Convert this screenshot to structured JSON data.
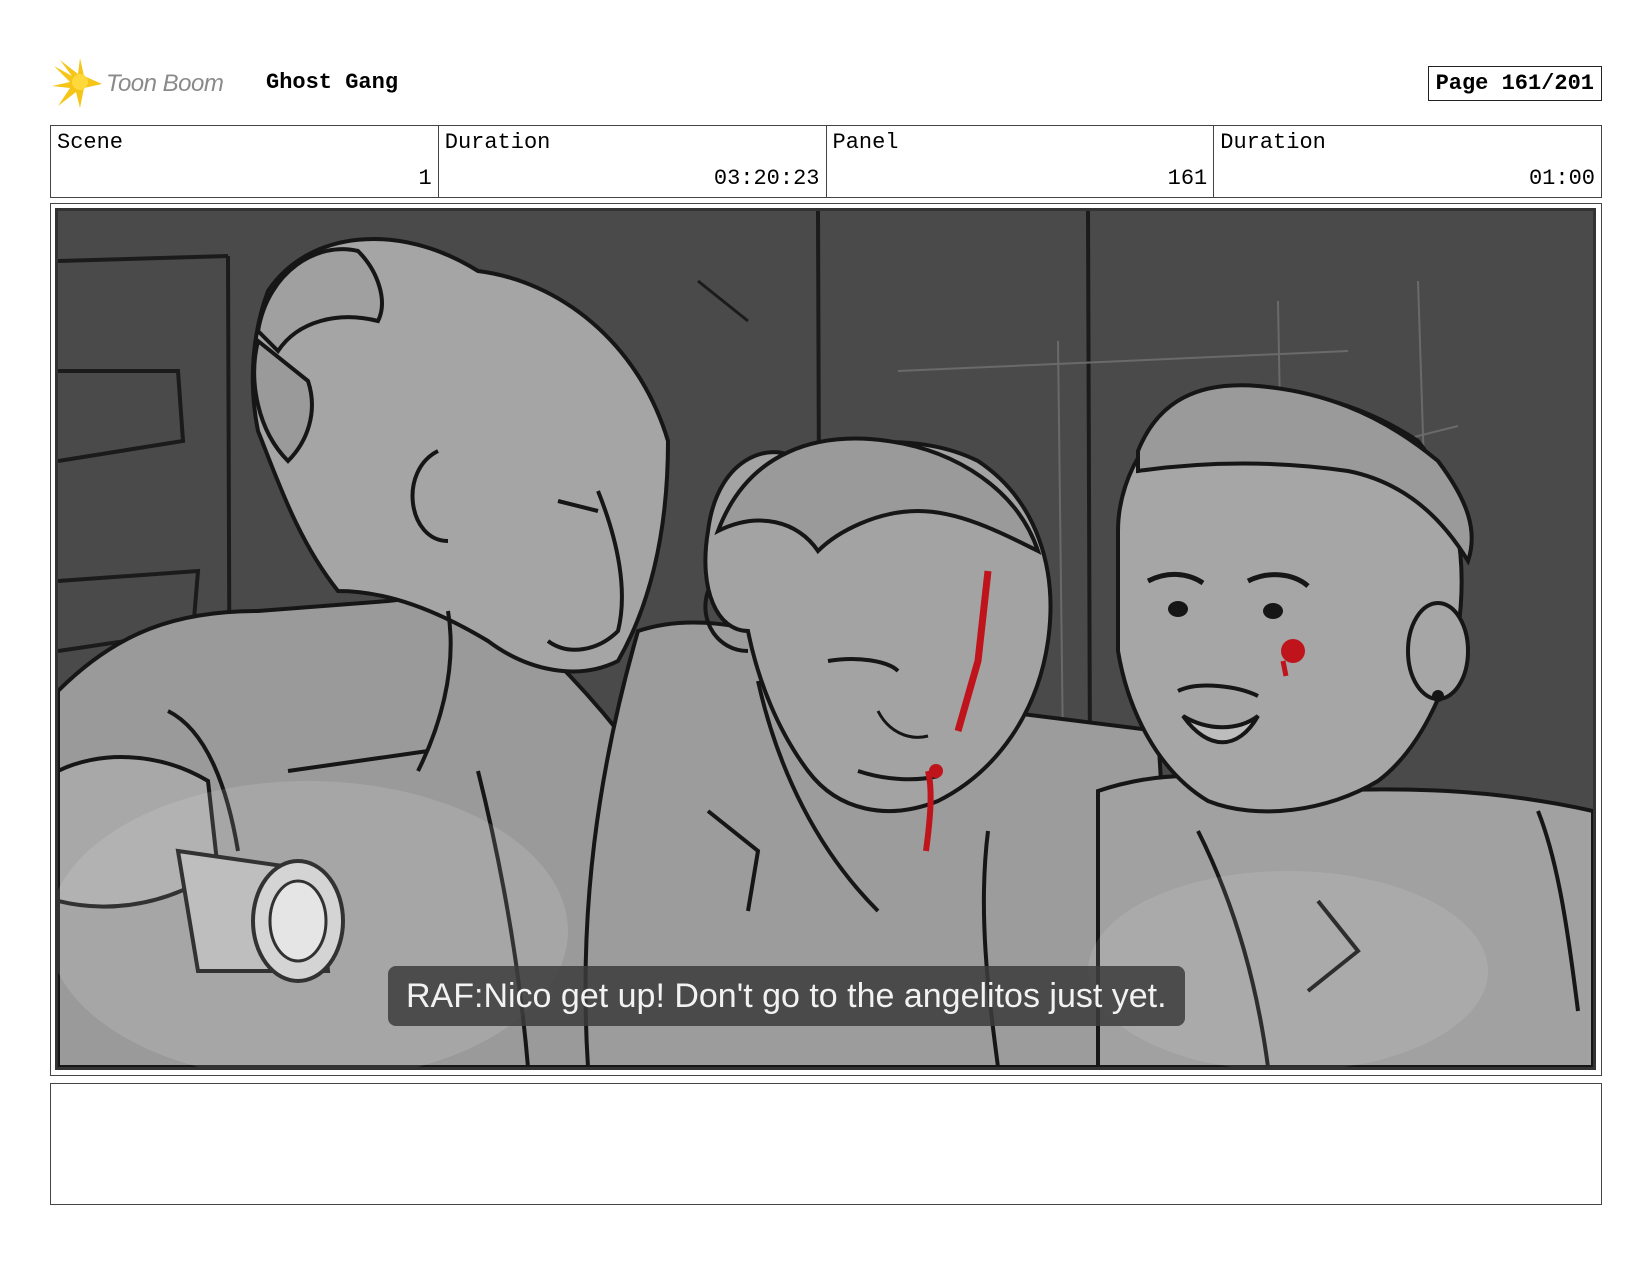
{
  "header": {
    "logo_text": "Toon Boom",
    "project_title": "Ghost Gang",
    "page_label": "Page 161/201"
  },
  "info": {
    "scene_label": "Scene",
    "scene_value": "1",
    "scene_duration_label": "Duration",
    "scene_duration_value": "03:20:23",
    "panel_label": "Panel",
    "panel_value": "161",
    "panel_duration_label": "Duration",
    "panel_duration_value": "01:00"
  },
  "panel": {
    "subtitle": "RAF:Nico get up! Don't go to the angelitos just yet."
  },
  "notes": {
    "text": ""
  },
  "colors": {
    "logo_accent": "#f5c518",
    "blood": "#c0141c",
    "background_dark": "#4a4a4a"
  }
}
